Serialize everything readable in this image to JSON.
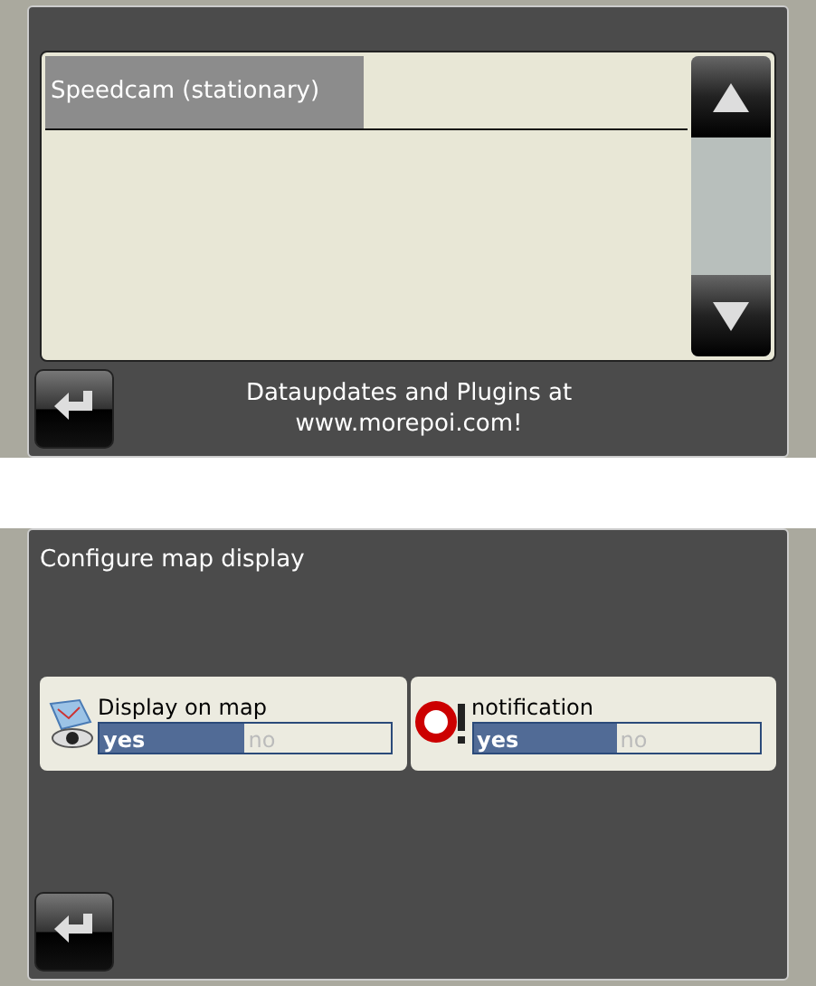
{
  "list_screen": {
    "items": [
      {
        "label": "Speedcam (stationary)",
        "selected": true
      }
    ],
    "footer_text": "Dataupdates and Plugins at",
    "footer_link": "www.morepoi.com!"
  },
  "config_screen": {
    "title": "Configure map display",
    "settings": [
      {
        "kind": "map",
        "label": "Display on map",
        "options": [
          {
            "label": "yes",
            "selected": true
          },
          {
            "label": "no",
            "selected": false
          }
        ]
      },
      {
        "kind": "alert",
        "label": "notification",
        "options": [
          {
            "label": "yes",
            "selected": true
          },
          {
            "label": "no",
            "selected": false
          }
        ]
      }
    ]
  }
}
